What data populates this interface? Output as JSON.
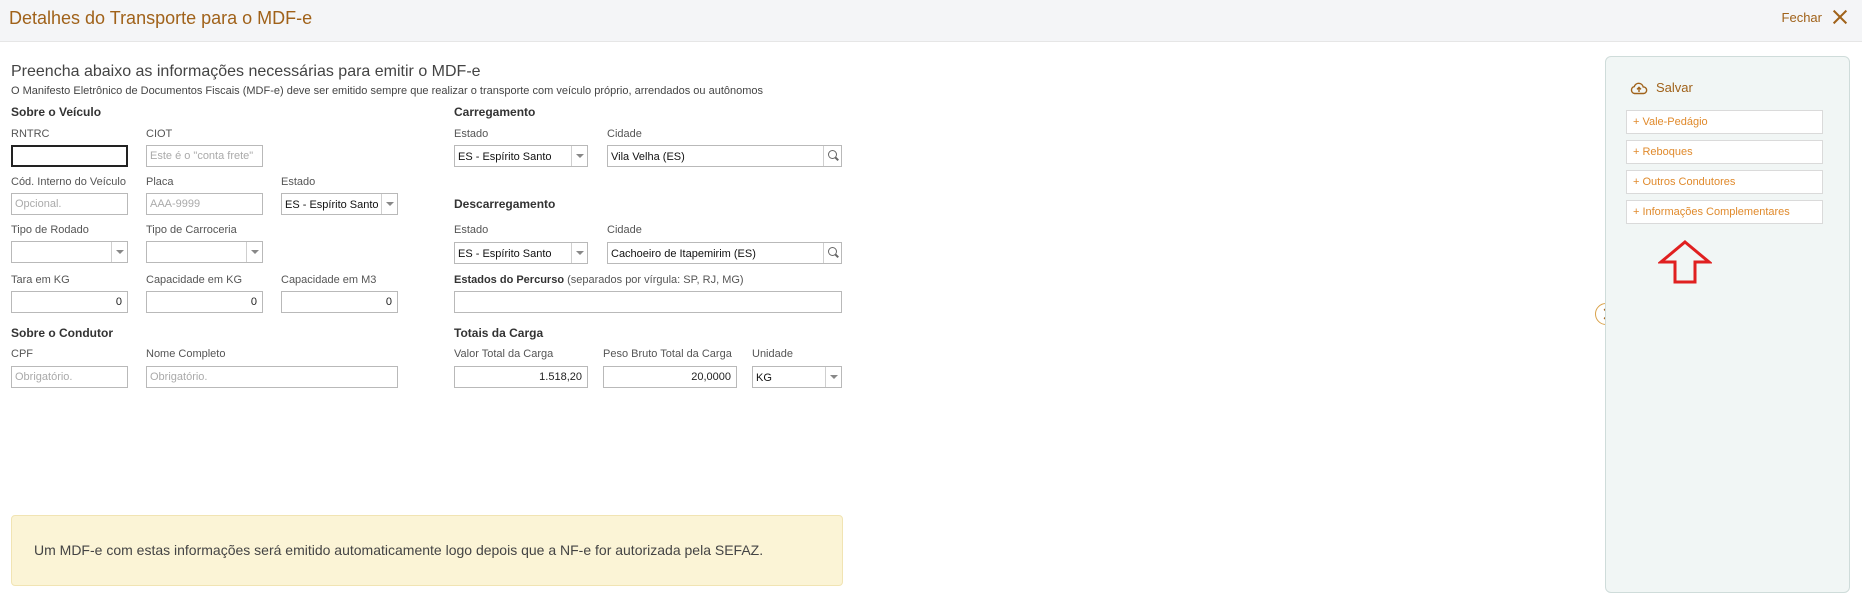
{
  "header": {
    "title": "Detalhes do Transporte para o MDF-e",
    "close_label": "Fechar"
  },
  "intro": {
    "title": "Preencha abaixo as informações necessárias para emitir o MDF-e",
    "subtitle": "O Manifesto Eletrônico de Documentos Fiscais (MDF-e) deve ser emitido sempre que realizar o transporte com veículo próprio, arrendados ou autônomos"
  },
  "vehicle": {
    "section": "Sobre o Veículo",
    "rntrc_label": "RNTRC",
    "rntrc_value": "",
    "ciot_label": "CIOT",
    "ciot_placeholder": "Este é o \"conta frete\"",
    "cod_interno_label": "Cód. Interno do Veículo",
    "cod_interno_placeholder": "Opcional.",
    "placa_label": "Placa",
    "placa_placeholder": "AAA-9999",
    "estado_label": "Estado",
    "estado_value": "ES - Espírito Santo",
    "rodado_label": "Tipo de Rodado",
    "rodado_value": "",
    "carroceria_label": "Tipo de Carroceria",
    "carroceria_value": "",
    "tara_label": "Tara em KG",
    "tara_value": "0",
    "cap_kg_label": "Capacidade em KG",
    "cap_kg_value": "0",
    "cap_m3_label": "Capacidade em M3",
    "cap_m3_value": "0"
  },
  "driver": {
    "section": "Sobre o Condutor",
    "cpf_label": "CPF",
    "cpf_placeholder": "Obrigatório.",
    "nome_label": "Nome Completo",
    "nome_placeholder": "Obrigatório."
  },
  "loading": {
    "section": "Carregamento",
    "estado_label": "Estado",
    "estado_value": "ES - Espírito Santo",
    "cidade_label": "Cidade",
    "cidade_value": "Vila Velha (ES)"
  },
  "unloading": {
    "section": "Descarregamento",
    "estado_label": "Estado",
    "estado_value": "ES - Espírito Santo",
    "cidade_label": "Cidade",
    "cidade_value": "Cachoeiro de Itapemirim (ES)"
  },
  "route": {
    "label_bold": "Estados do Percurso",
    "label_hint": " (separados por vírgula: SP, RJ, MG)",
    "value": ""
  },
  "totals": {
    "section": "Totais da Carga",
    "valor_label": "Valor Total da Carga",
    "valor_value": "1.518,20",
    "peso_label": "Peso Bruto Total da Carga",
    "peso_value": "20,0000",
    "unidade_label": "Unidade",
    "unidade_value": "KG"
  },
  "notice": "Um MDF-e com estas informações será emitido automaticamente logo depois que a NF-e for autorizada pela SEFAZ.",
  "sidebar": {
    "save_label": "Salvar",
    "items": [
      {
        "label": "Vale-Pedágio"
      },
      {
        "label": "Reboques"
      },
      {
        "label": "Outros Condutores"
      },
      {
        "label": "Informações Complementares"
      }
    ]
  },
  "colors": {
    "accent": "#a0621a",
    "link": "#e08a2c",
    "annotation": "#e02020"
  },
  "icons": [
    "close-icon",
    "cloud-upload-icon",
    "search-icon",
    "chevron-right-icon",
    "up-arrow-annotation"
  ]
}
